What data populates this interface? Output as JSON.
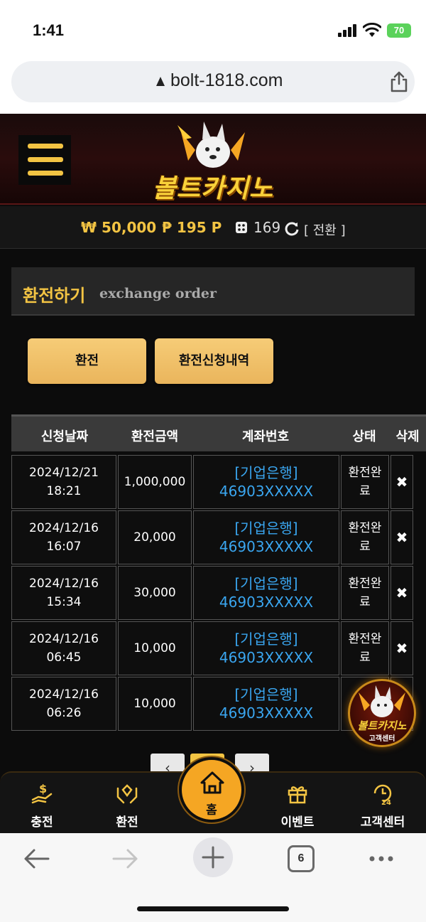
{
  "status_bar": {
    "time": "1:41",
    "battery": "70"
  },
  "browser": {
    "url": "bolt-1818.com",
    "tab_count": "6"
  },
  "site": {
    "logo_text": "볼트카지노",
    "balance": {
      "won_symbol": "₩",
      "won_value": "50,000",
      "point_symbol": "₱",
      "point_value": "195 P",
      "chip_value": "169",
      "convert_label": "[ 전환 ]"
    },
    "section": {
      "title_kr": "환전하기",
      "title_en": "exchange order"
    },
    "buttons": {
      "exchange": "환전",
      "history": "환전신청내역"
    },
    "table": {
      "headers": [
        "신청날짜",
        "환전금액",
        "계좌번호",
        "상태",
        "삭제"
      ],
      "rows": [
        {
          "date": "2024/12/21",
          "time": "18:21",
          "amount": "1,000,000",
          "bank": "[기업은행]",
          "account": "46903XXXXX",
          "status1": "환전완",
          "status2": "료",
          "delete": "✖"
        },
        {
          "date": "2024/12/16",
          "time": "16:07",
          "amount": "20,000",
          "bank": "[기업은행]",
          "account": "46903XXXXX",
          "status1": "환전완",
          "status2": "료",
          "delete": "✖"
        },
        {
          "date": "2024/12/16",
          "time": "15:34",
          "amount": "30,000",
          "bank": "[기업은행]",
          "account": "46903XXXXX",
          "status1": "환전완",
          "status2": "료",
          "delete": "✖"
        },
        {
          "date": "2024/12/16",
          "time": "06:45",
          "amount": "10,000",
          "bank": "[기업은행]",
          "account": "46903XXXXX",
          "status1": "환전완",
          "status2": "료",
          "delete": "✖"
        },
        {
          "date": "2024/12/16",
          "time": "06:26",
          "amount": "10,000",
          "bank": "[기업은행]",
          "account": "46903XXXXX",
          "status1": "환",
          "status2": "",
          "delete": ""
        }
      ]
    },
    "chat_badge": {
      "line1": "볼트카지노",
      "line2": "고객센터"
    },
    "pager": {
      "prev": "‹",
      "next": "›"
    },
    "bottom_nav": {
      "deposit": "충전",
      "exchange": "환전",
      "home": "홈",
      "event": "이벤트",
      "support": "고객센터"
    }
  },
  "colors": {
    "accent": "#f3c443",
    "button": "#eab55c",
    "link": "#3aa6f0",
    "home": "#f5a623"
  }
}
